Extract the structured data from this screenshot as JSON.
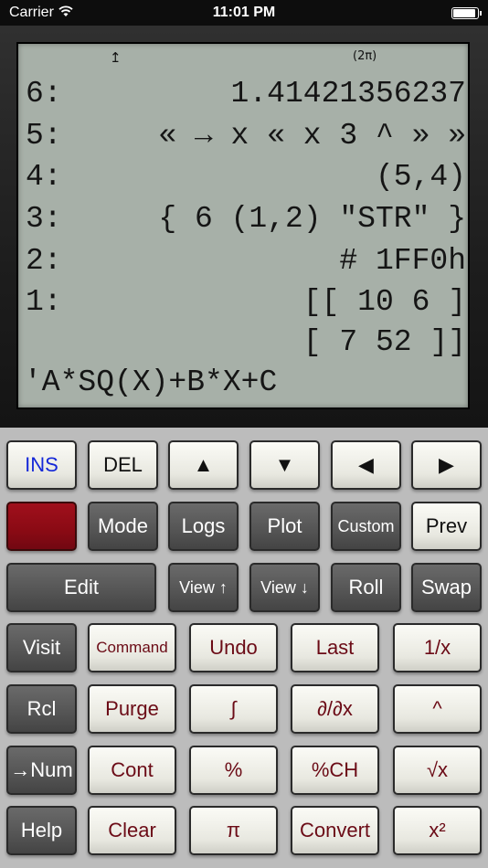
{
  "status_bar": {
    "carrier": "Carrier",
    "time": "11:01 PM"
  },
  "display": {
    "annunciators": {
      "shift_arrow": "↥",
      "angle_mode": "(2π)"
    },
    "stack": [
      {
        "level": "6:",
        "value": "1.41421356237"
      },
      {
        "level": "5:",
        "value": "« → x « x 3 ^ » »"
      },
      {
        "level": "4:",
        "value": "(5,4)"
      },
      {
        "level": "3:",
        "value": "{ 6 (1,2) \"STR\" }"
      },
      {
        "level": "2:",
        "value": "# 1FF0h"
      },
      {
        "level": "1:",
        "value": "[[ 10 6 ]"
      }
    ],
    "stack_continuation": "[ 7 52 ]]",
    "command_line": "'A*SQ(X)+B*X+C"
  },
  "keys": {
    "row1": {
      "ins": "INS",
      "del": "DEL",
      "up": "▲",
      "down": "▼",
      "left": "◀",
      "right": "▶"
    },
    "row2": {
      "mode": "Mode",
      "logs": "Logs",
      "plot": "Plot",
      "custom": "Custom",
      "prev": "Prev"
    },
    "row3": {
      "edit": "Edit",
      "view_up": "View ↑",
      "view_down": "View ↓",
      "roll": "Roll",
      "swap": "Swap"
    },
    "row4": {
      "visit": "Visit",
      "command": "Command",
      "undo": "Undo",
      "last": "Last",
      "inv": "1/x"
    },
    "row5": {
      "rcl": "Rcl",
      "purge": "Purge",
      "integral": "∫",
      "deriv": "∂/∂x",
      "power": "^"
    },
    "row6": {
      "num": "→Num",
      "cont": "Cont",
      "percent": "%",
      "pct_change": "%CH",
      "sqrt": "√x"
    },
    "row7": {
      "help": "Help",
      "clear": "Clear",
      "pi": "π",
      "convert": "Convert",
      "square": "x²"
    }
  }
}
